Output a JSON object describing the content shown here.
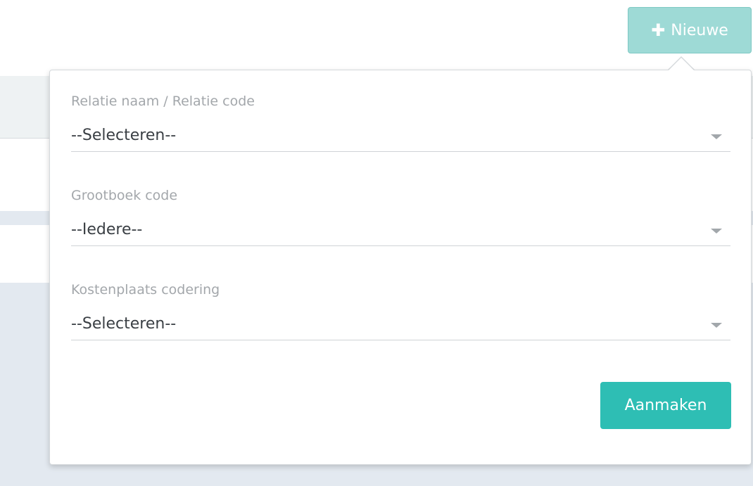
{
  "toolbar": {
    "new_label": "Nieuwe",
    "new_icon": "plus-icon"
  },
  "popover": {
    "fields": [
      {
        "label": "Relatie naam / Relatie code",
        "value": "--Selecteren--"
      },
      {
        "label": "Grootboek code",
        "value": "--Iedere--"
      },
      {
        "label": "Kostenplaats codering",
        "value": "--Selecteren--"
      }
    ],
    "submit_label": "Aanmaken"
  },
  "colors": {
    "accent": "#2ebeb4",
    "accent_light": "#9edad6",
    "label_gray": "#a3a7ab"
  }
}
